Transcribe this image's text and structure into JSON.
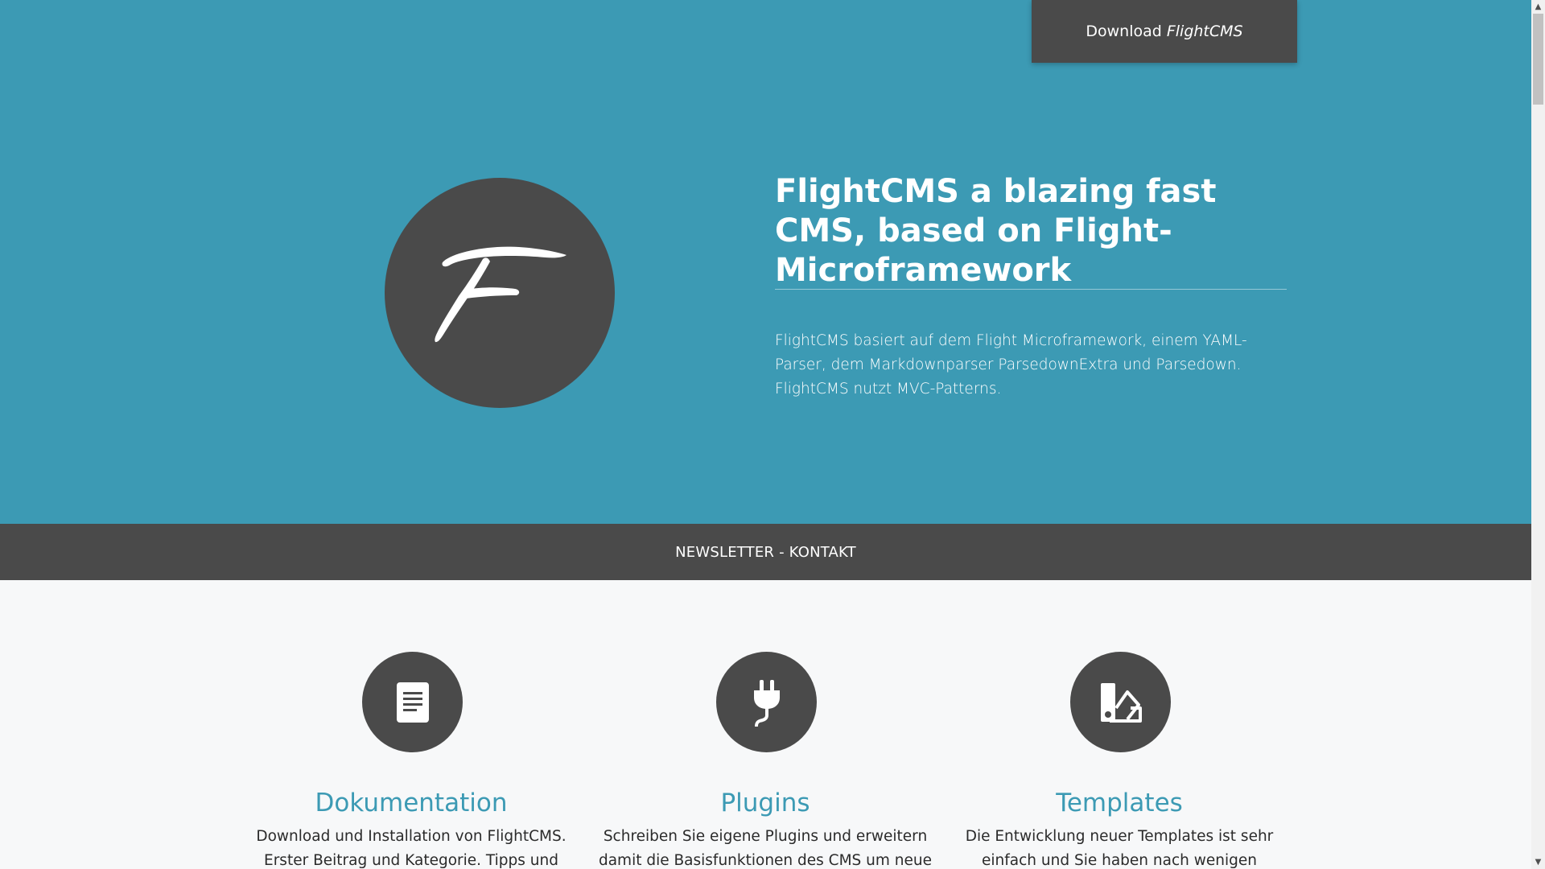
{
  "header": {
    "download_label": "Download",
    "download_brand": "FlightCMS"
  },
  "hero": {
    "logo_letter": "F",
    "title": "FlightCMS a blazing fast CMS, based on Flight-Microframework",
    "description": "FlightCMS basiert auf dem Flight Microframework, einem YAML-Parser, dem Markdownparser ParsedownExtra und Parsedown. FlightCMS nutzt MVC-Patterns."
  },
  "nav": {
    "newsletter_link": "NEWSLETTER - KONTAKT"
  },
  "features": [
    {
      "icon": "document-icon",
      "title": "Dokumentation",
      "text": "Download und Installation von FlightCMS. Erster Beitrag und Kategorie. Tipps und Tricks"
    },
    {
      "icon": "plug-icon",
      "title": "Plugins",
      "text": "Schreiben Sie eigene Plugins und erweitern damit die Basisfunktionen des CMS um neue"
    },
    {
      "icon": "swatchbook-icon",
      "title": "Templates",
      "text": "Die Entwicklung neuer Templates ist sehr einfach und Sie haben nach wenigen Minuten"
    }
  ],
  "colors": {
    "hero_background": "#3c9ab4",
    "dark": "#4a4a4a",
    "accent": "#3c9ab4",
    "page_background": "#f7f8f9"
  }
}
